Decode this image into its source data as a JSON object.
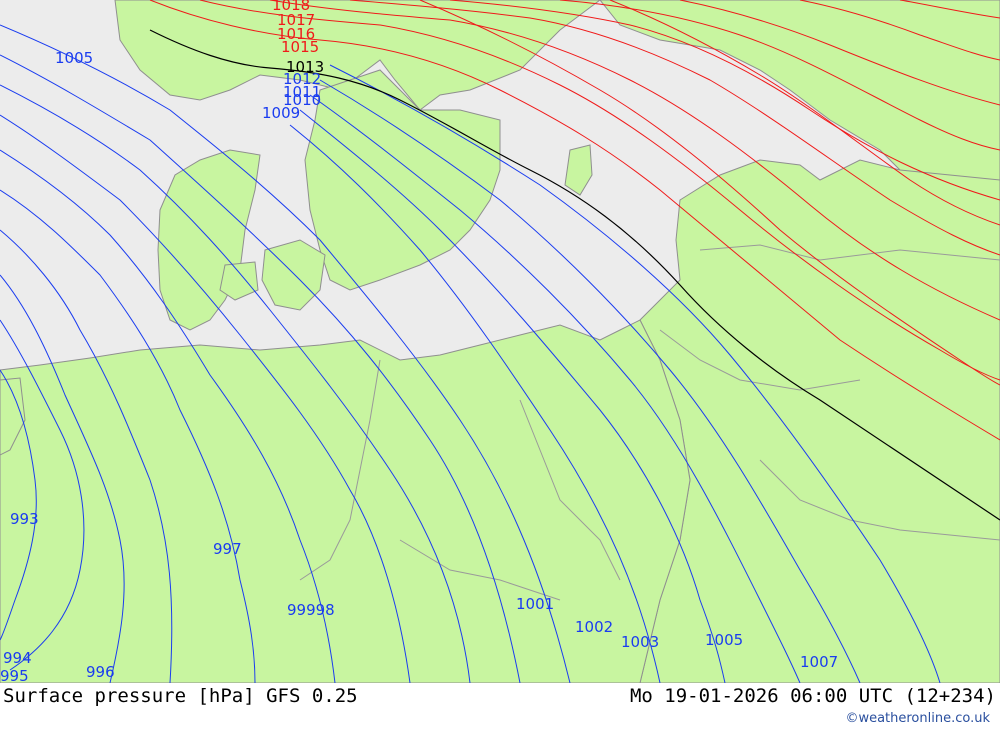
{
  "title": "Surface pressure [hPa] GFS 0.25",
  "valid_time": "Mo 19-01-2026 06:00 UTC (12+234)",
  "credit": "©weatheronline.co.uk",
  "colors": {
    "land": "#c8f5a0",
    "sea": "#ececec",
    "low_isobar": "#1a3cf0",
    "high_isobar": "#f01a1a",
    "reference_isobar": "#000000",
    "border": "#999999"
  },
  "isobar_labels": [
    {
      "text": "1018",
      "color": "red"
    },
    {
      "text": "1017",
      "color": "red"
    },
    {
      "text": "1016",
      "color": "red"
    },
    {
      "text": "1015",
      "color": "red"
    },
    {
      "text": "1013",
      "color": "black"
    },
    {
      "text": "1012",
      "color": "blue"
    },
    {
      "text": "1011",
      "color": "blue"
    },
    {
      "text": "1010",
      "color": "blue"
    },
    {
      "text": "1009",
      "color": "blue"
    },
    {
      "text": "1005",
      "color": "blue"
    },
    {
      "text": "993",
      "color": "blue"
    },
    {
      "text": "997",
      "color": "blue"
    },
    {
      "text": "99998",
      "color": "blue"
    },
    {
      "text": "1001",
      "color": "blue"
    },
    {
      "text": "1002",
      "color": "blue"
    },
    {
      "text": "1003",
      "color": "blue"
    },
    {
      "text": "1005",
      "color": "blue"
    },
    {
      "text": "1007",
      "color": "blue"
    },
    {
      "text": "994",
      "color": "blue"
    },
    {
      "text": "995",
      "color": "blue"
    },
    {
      "text": "996",
      "color": "blue"
    }
  ]
}
